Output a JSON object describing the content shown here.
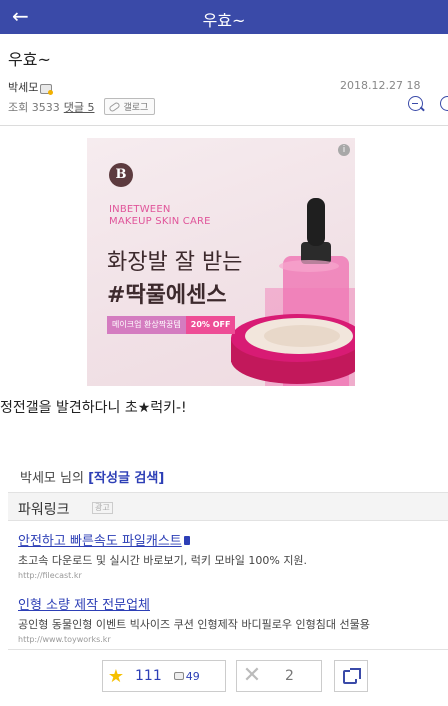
{
  "header": {
    "back_icon": "arrow-left-icon",
    "back_glyph": "←",
    "title": "우효~"
  },
  "post": {
    "title": "우효~",
    "author": "박세모",
    "date": "2018.12.27 18",
    "stats": "조회 3533",
    "comments_label": "댓글 5",
    "gallery_label": "갤로그"
  },
  "ad": {
    "logo": "B",
    "info": "i",
    "brand_line1": "INBETWEEN",
    "brand_line2": "MAKEUP SKIN CARE",
    "headline_line1": "화장발 잘 받는",
    "headline_line2": "#딱풀에센스",
    "promo_left": "메이크업 환상짝꿍템",
    "promo_right": "20% OFF"
  },
  "content": {
    "body": "정전갤을 발견하다니 초★럭키-!"
  },
  "author_search": {
    "prefix": "박세모 님의 ",
    "link": "[작성글 검색]"
  },
  "powerlink": {
    "title": "파워링크",
    "badge": "광고",
    "items": [
      {
        "title": "안전하고 빠른속도 파일캐스트",
        "desc": "초고속 다운로드 및 실시간 바로보기, 럭키 모바일 100% 지원.",
        "url": "http://filecast.kr"
      },
      {
        "title": "인형 소량 제작 전문업체",
        "desc": "공인형 동물인형 이벤트 빅사이즈 쿠션 인형제작 바디필로우 인형침대 선물용",
        "url": "http://www.toyworks.kr"
      }
    ]
  },
  "actions": {
    "recommend_count": "111",
    "recommend_sub": "49",
    "downvote_count": "2"
  },
  "colors": {
    "header_bg": "#3a4aa8",
    "link": "#2d3fb6",
    "star": "#f6c000"
  }
}
